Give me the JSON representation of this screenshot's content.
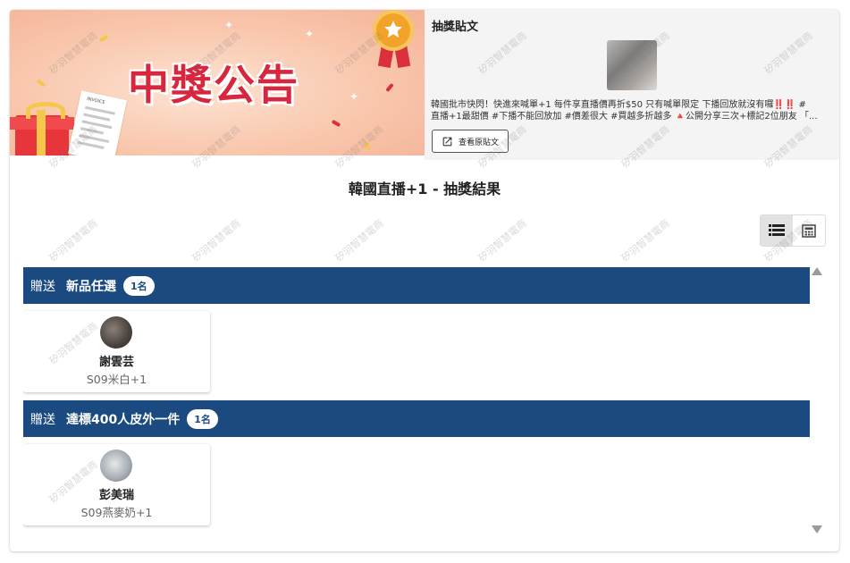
{
  "banner": {
    "title": "中獎公告",
    "receipt_text": "INVOICE"
  },
  "post": {
    "label": "抽獎貼文",
    "text_line1": "韓國批市快閃！快進來喊單+1 每件享直播價再折$50 只有喊單限定 下播回放就沒有囉‼️‼️ #",
    "text_line2": "直播+1最甜價 #下播不能回放加 #價差很大 #買越多折越多 🔺公開分享三次+標記2位朋友 「...",
    "view_button": "查看原貼文"
  },
  "result_title": "韓國直播+1 - 抽獎結果",
  "view_toggle": {
    "list_icon": "list-view-icon",
    "grid_icon": "grid-view-icon"
  },
  "prizes": [
    {
      "gift_word": "贈送",
      "name": "新品任選",
      "count": "1名",
      "winners": [
        {
          "name": "謝雲芸",
          "item": "S09米白+1",
          "avatar_icon": "user-avatar"
        }
      ]
    },
    {
      "gift_word": "贈送",
      "name": "達標400人皮外一件",
      "count": "1名",
      "winners": [
        {
          "name": "彭美瑞",
          "item": "S09燕麥奶+1",
          "avatar_icon": "user-avatar"
        }
      ]
    }
  ],
  "watermark": "矽羽智慧電商",
  "colors": {
    "header_blue": "#1a4a80",
    "banner_red": "#d7263d"
  }
}
